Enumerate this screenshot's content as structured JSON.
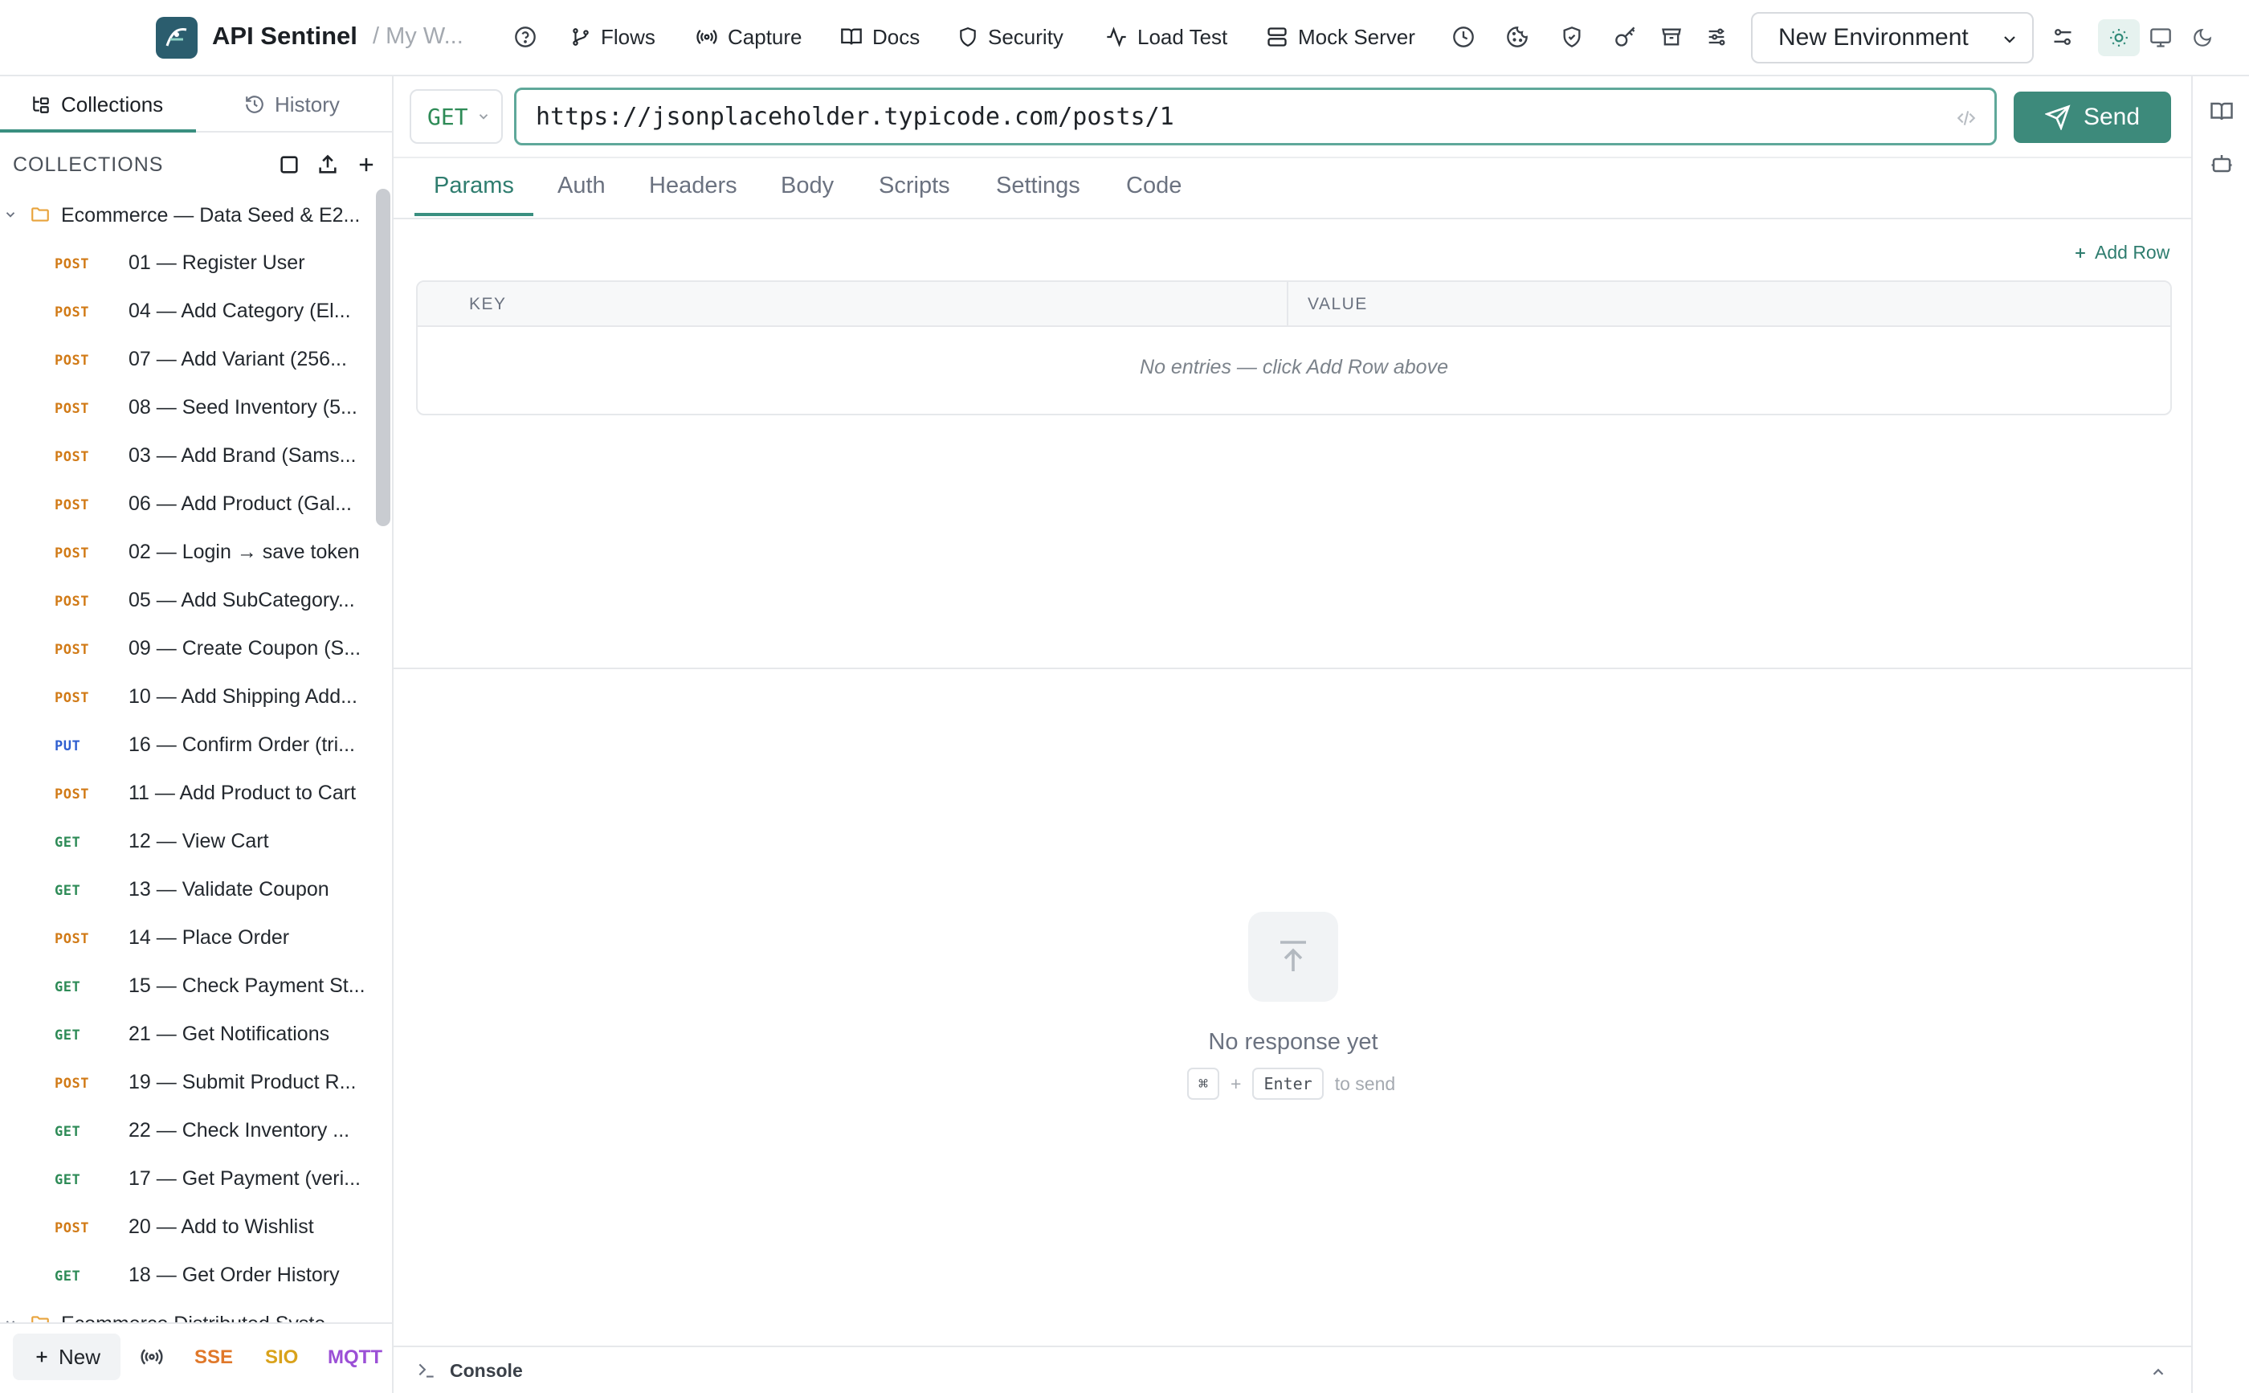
{
  "app": {
    "title": "API Sentinel",
    "workspace": "/ My W..."
  },
  "nav": {
    "flows": "Flows",
    "capture": "Capture",
    "docs": "Docs",
    "security": "Security",
    "load_test": "Load Test",
    "mock_server": "Mock Server"
  },
  "environment": {
    "selected": "New Environment"
  },
  "sidebar": {
    "tabs": {
      "collections": "Collections",
      "history": "History"
    },
    "section_label": "COLLECTIONS",
    "folders": [
      "Ecommerce — Data Seed & E2...",
      "Ecommerce Distributed Syste..."
    ],
    "requests": [
      {
        "method": "POST",
        "name": "01 — Register User"
      },
      {
        "method": "POST",
        "name": "04 — Add Category (El..."
      },
      {
        "method": "POST",
        "name": "07 — Add Variant (256..."
      },
      {
        "method": "POST",
        "name": "08 — Seed Inventory (5..."
      },
      {
        "method": "POST",
        "name": "03 — Add Brand (Sams..."
      },
      {
        "method": "POST",
        "name": "06 — Add Product (Gal..."
      },
      {
        "method": "POST",
        "name": "02 — Login → save token"
      },
      {
        "method": "POST",
        "name": "05 — Add SubCategory..."
      },
      {
        "method": "POST",
        "name": "09 — Create Coupon (S..."
      },
      {
        "method": "POST",
        "name": "10 — Add Shipping Add..."
      },
      {
        "method": "PUT",
        "name": "16 — Confirm Order (tri..."
      },
      {
        "method": "POST",
        "name": "11 — Add Product to Cart"
      },
      {
        "method": "GET",
        "name": "12 — View Cart"
      },
      {
        "method": "GET",
        "name": "13 — Validate Coupon"
      },
      {
        "method": "POST",
        "name": "14 — Place Order"
      },
      {
        "method": "GET",
        "name": "15 — Check Payment St..."
      },
      {
        "method": "GET",
        "name": "21 — Get Notifications"
      },
      {
        "method": "POST",
        "name": "19 — Submit Product R..."
      },
      {
        "method": "GET",
        "name": "22 — Check Inventory ..."
      },
      {
        "method": "GET",
        "name": "17 — Get Payment (veri..."
      },
      {
        "method": "POST",
        "name": "20 — Add to Wishlist"
      },
      {
        "method": "GET",
        "name": "18 — Get Order History"
      }
    ],
    "footer": {
      "new_label": "New",
      "sse": "SSE",
      "sio": "SIO",
      "mqtt": "MQTT"
    }
  },
  "request": {
    "method": "GET",
    "url": "https://jsonplaceholder.typicode.com/posts/1",
    "send_label": "Send",
    "tabs": [
      "Params",
      "Auth",
      "Headers",
      "Body",
      "Scripts",
      "Settings",
      "Code"
    ],
    "active_tab": "Params",
    "add_row_label": "Add Row",
    "columns": {
      "key": "KEY",
      "value": "VALUE"
    },
    "empty_text": "No entries — click Add Row above"
  },
  "response": {
    "empty_title": "No response yet",
    "hint": {
      "key1": "⌘",
      "plus": "+",
      "key2": "Enter",
      "suffix": "to send"
    }
  },
  "console": {
    "label": "Console"
  },
  "colors": {
    "accent": "#3d8a7b",
    "post": "#d17a16",
    "get": "#2e8b57",
    "put": "#2f5fd0",
    "sse": "#e0782a",
    "sio": "#d9a21b",
    "mqtt": "#9b4fd6"
  }
}
